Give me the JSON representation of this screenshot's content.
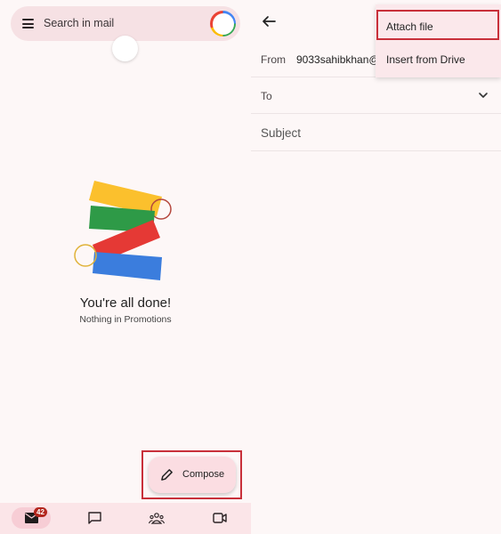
{
  "left_panel": {
    "search": {
      "placeholder": "Search in mail"
    },
    "empty_state": {
      "title": "You're all done!",
      "subtitle": "Nothing in Promotions"
    },
    "compose": {
      "label": "Compose"
    },
    "bottom_nav": {
      "items": [
        {
          "name": "Mail",
          "icon": "mail-icon",
          "badge": "42",
          "active": true
        },
        {
          "name": "Chat",
          "icon": "chat-icon"
        },
        {
          "name": "Spaces",
          "icon": "spaces-icon"
        },
        {
          "name": "Meet",
          "icon": "video-icon"
        }
      ]
    }
  },
  "right_panel": {
    "compose_form": {
      "from_label": "From",
      "from_value": "9033sahibkhan@",
      "to_label": "To",
      "subject_placeholder": "Subject"
    },
    "attach_menu": {
      "items": [
        {
          "label": "Attach file",
          "highlighted": true
        },
        {
          "label": "Insert from Drive"
        }
      ]
    }
  },
  "colors": {
    "highlight_border": "#c8303a",
    "badge": "#b3261e",
    "compose_bg": "#fbdde2",
    "background": "#fdf7f7"
  }
}
